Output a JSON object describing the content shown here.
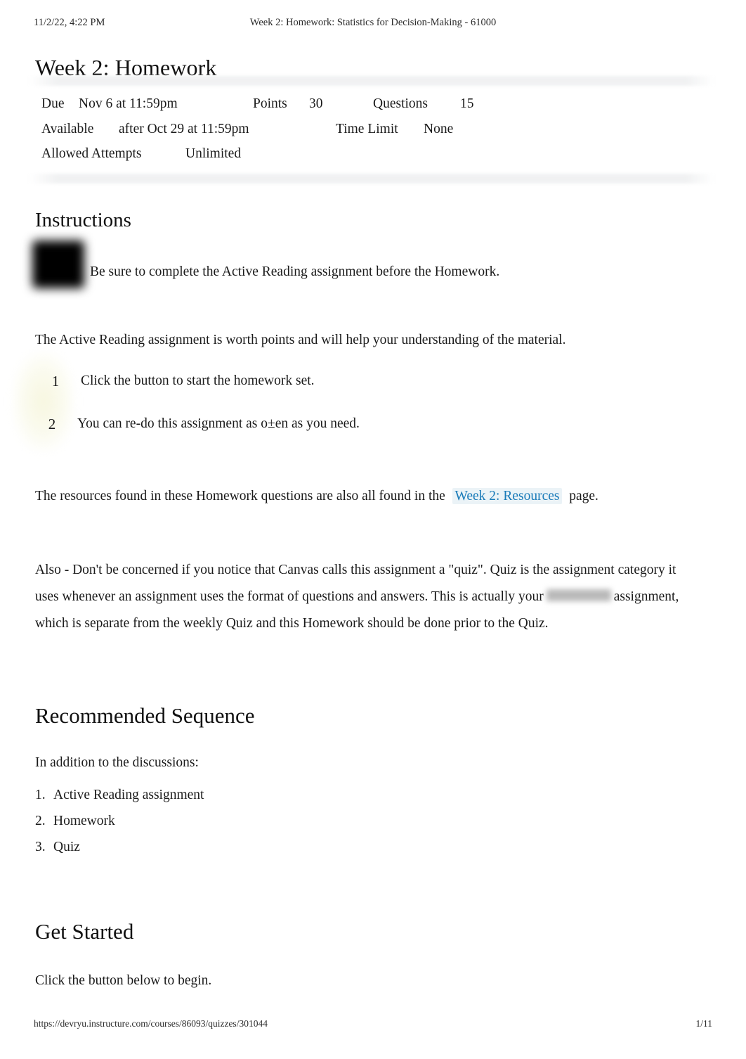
{
  "print_header": {
    "date": "11/2/22, 4:22 PM",
    "title": "Week 2: Homework: Statistics for Decision-Making - 61000"
  },
  "page_title": "Week 2: Homework",
  "meta": {
    "due_label": "Due",
    "due_value": "Nov 6 at 11:59pm",
    "points_label": "Points",
    "points_value": "30",
    "questions_label": "Questions",
    "questions_value": "15",
    "available_label": "Available",
    "available_value": "after Oct 29 at 11:59pm",
    "time_limit_label": "Time Limit",
    "time_limit_value": "None",
    "allowed_attempts_label": "Allowed Attempts",
    "allowed_attempts_value": "Unlimited"
  },
  "instructions": {
    "heading": "Instructions",
    "callout": "Be sure to complete the Active Reading assignment before the Homework.",
    "worth_paragraph": "The Active Reading assignment is worth points and will help your understanding of the material.",
    "steps": [
      {
        "number": "1",
        "text": "Click the button to start the homework set."
      },
      {
        "number": "2",
        "text": "You can re-do this assignment as o±en as you need."
      }
    ],
    "resources_before": "The resources found in these Homework questions are also all found in the",
    "resources_link": "Week 2: Resources",
    "resources_after": "page.",
    "also_part1": "Also - Don't be concerned if you notice that Canvas calls this assignment a \"quiz\". Quiz is the assignment category it uses whenever an assignment uses the format of questions and answers. This is actually your",
    "also_part2": "assignment, which is separate from the weekly Quiz and this Homework should be done prior to the Quiz."
  },
  "recommended": {
    "heading": "Recommended Sequence",
    "intro": "In addition to the discussions:",
    "items": [
      {
        "mark": "1.",
        "text": "Active Reading assignment"
      },
      {
        "mark": "2.",
        "text": "Homework"
      },
      {
        "mark": "3.",
        "text": "Quiz"
      }
    ]
  },
  "get_started": {
    "heading": "Get Started",
    "text": "Click the button below to begin."
  },
  "print_footer": {
    "url": "https://devryu.instructure.com/courses/86093/quizzes/301044",
    "page": "1/11"
  },
  "colors": {
    "link": "#1a7bb9",
    "text": "#1a1a1a",
    "meta_bar": "#f0f1f2",
    "highlight_yellow": "#f7f6de",
    "highlight_blue": "#e7f1f6"
  }
}
